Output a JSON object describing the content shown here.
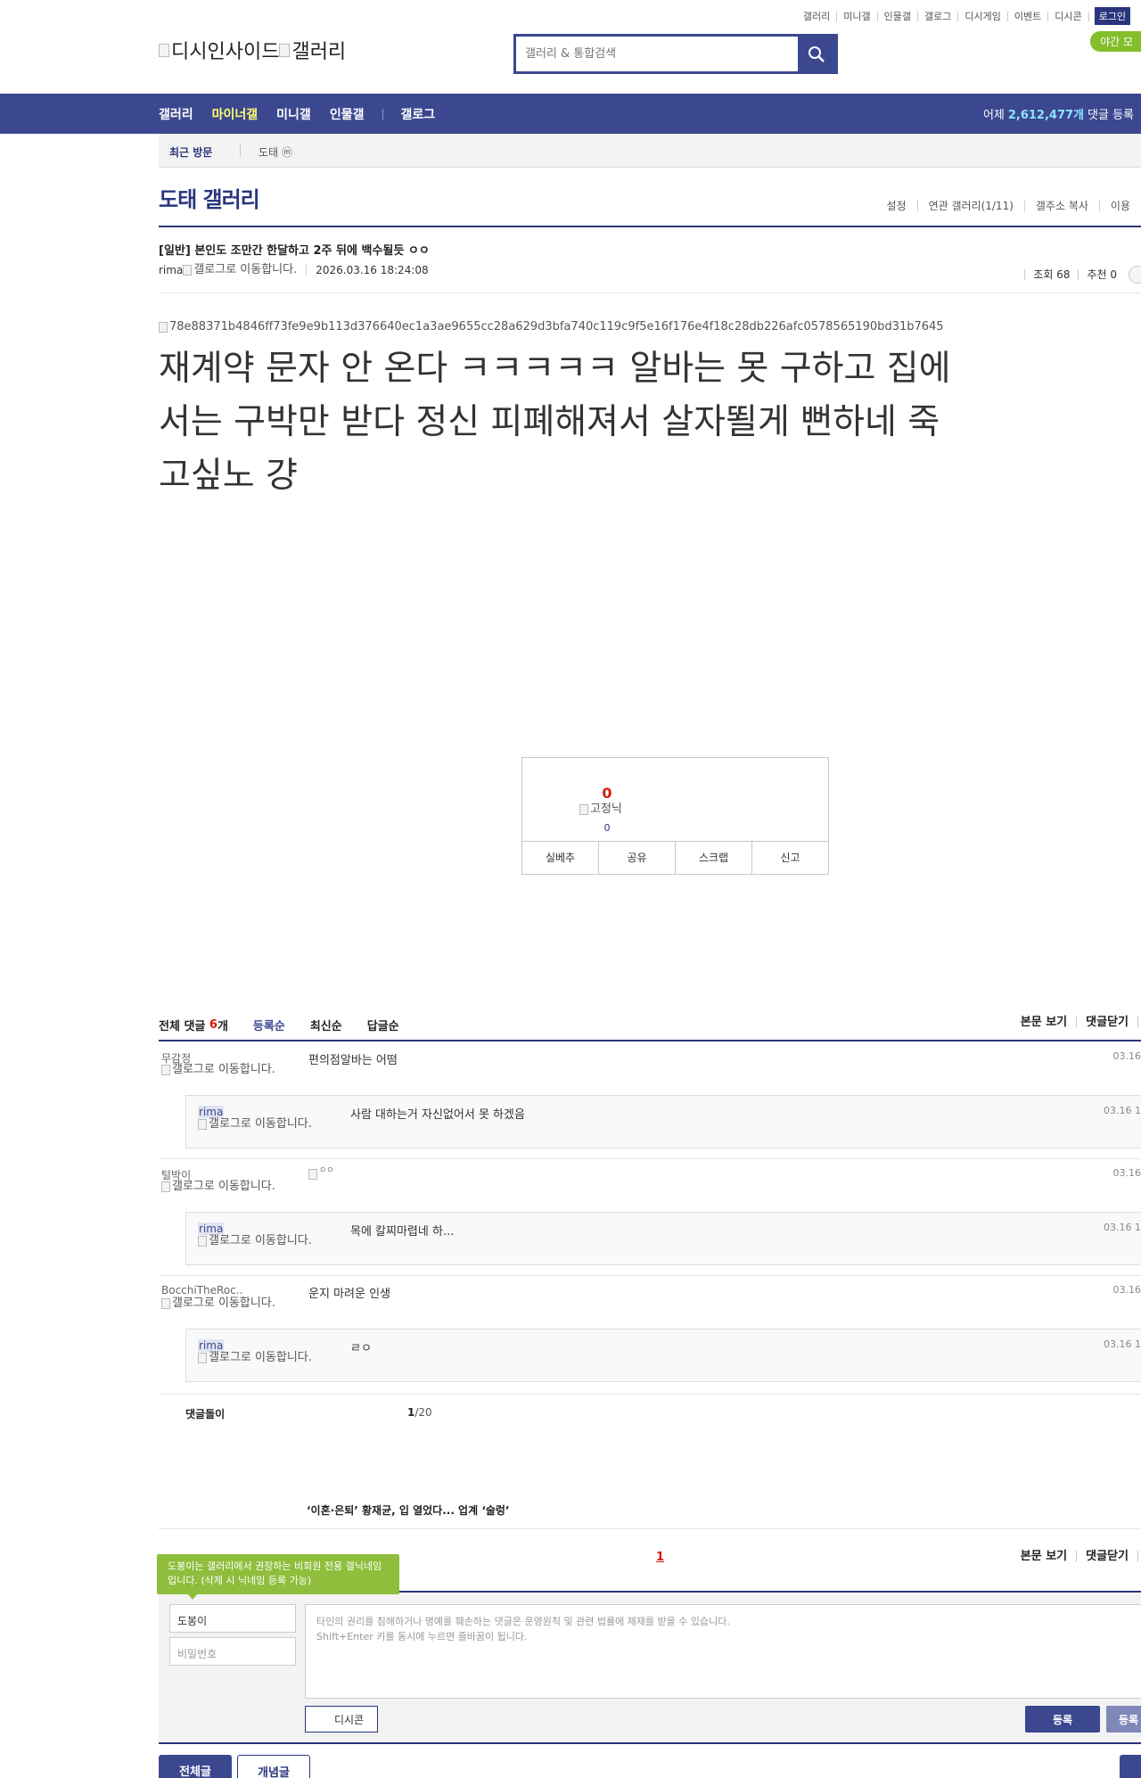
{
  "header": {
    "top_links": [
      "갤러리",
      "미니갤",
      "인물갤",
      "갤로그",
      "디시게임",
      "이벤트",
      "디시콘"
    ],
    "login_label": "로그인",
    "night_mode_label": "야간 모",
    "logo_alt": "디시인사이드",
    "logo_gallery_alt": "갤러리",
    "search_placeholder": "갤러리 & 통합검색"
  },
  "navbar": {
    "items": [
      "갤러리",
      "마이너갤",
      "미니갤",
      "인물갤"
    ],
    "active_index": 1,
    "gallog": "갤로그",
    "yesterday_prefix": "어제",
    "yesterday_count": "2,612,477개",
    "yesterday_suffix": "댓글 등록"
  },
  "recent": {
    "label": "최근 방문",
    "item": "도태 ⓜ"
  },
  "gallery": {
    "title": "도태 갤러리",
    "links": [
      "설정",
      "연관 갤러리(1/11)",
      "갤주소 복사",
      "이용"
    ]
  },
  "post": {
    "subject": "[일반] 본인도 조만간 한달하고 2주 뒤에 백수될듯 ㅇㅇ",
    "author": "rima",
    "author_icon_alt": "갤로그로 이동합니다.",
    "date": "2026.03.16 18:24:08",
    "views_label": "조회 68",
    "recommend_label": "추천 0",
    "image_alt": "78e88371b4846ff73fe9e9b113d376640ec1a3ae9655cc28a629d3bfa740c119c9f5e16f176e4f18c28db226afc0578565190bd31b7645",
    "body": "재계약 문자 안 온다 ㅋㅋㅋㅋㅋ 알바는 못 구하고 집에서는 구박만 받다 정신 피폐해져서 살자뙬게 뻔하네 죽고싶노 걍"
  },
  "recommend": {
    "up_count": "0",
    "fixed_alt": "고정닉",
    "fixed_count": "0",
    "buttons": [
      "실베추",
      "공유",
      "스크랩",
      "신고"
    ]
  },
  "comments_header": {
    "total_label": "전체 댓글",
    "total_count": "6",
    "total_unit": "개",
    "sort_tabs": [
      "등록순",
      "최신순",
      "답글순"
    ],
    "active_sort": 0,
    "right_links": [
      "본문 보기",
      "댓글닫기"
    ]
  },
  "comments": [
    {
      "nick": "무감정",
      "icon_alt": "갤로그로 이동합니다.",
      "text": "편의점알바는 어떰",
      "date": "03.16",
      "reply": {
        "nick": "rima",
        "icon_alt": "갤로그로 이동합니다.",
        "text": "사람 대하는거 자신없어서 못 하겠음",
        "date": "03.16 1"
      }
    },
    {
      "nick": "털박이",
      "icon_alt": "갤로그로 이동합니다.",
      "text": "",
      "dccon_alt": "ㅇㅇ",
      "date": "03.16",
      "reply": {
        "nick": "rima",
        "icon_alt": "갤로그로 이동합니다.",
        "text": "목에 칼찌마렵네 하...",
        "date": "03.16 1"
      }
    },
    {
      "nick": "BocchiTheRoc..",
      "icon_alt": "갤로그로 이동합니다.",
      "text": "운지 마려운 인생",
      "date": "03.16",
      "reply": {
        "nick": "rima",
        "icon_alt": "갤로그로 이동합니다.",
        "text": "ㄹㅇ",
        "date": "03.16 1"
      }
    }
  ],
  "paging": {
    "dolgo_label": "댓글돌이",
    "current": "1",
    "total": "/20"
  },
  "news_headline": "‘이혼·은퇴’ 황재균, 입 열었다... 업계 ‘술렁’",
  "bottom_pager": {
    "current": "1"
  },
  "write": {
    "tip": "도봉이는 갤러리에서 권장하는 비회원 전용 갤닉네임입니다. (삭제 시 닉네임 등록 가능)",
    "nick_value": "도봉이",
    "password_placeholder": "비밀번호",
    "memo_placeholder_1": "타인의 권리를 침해하거나 명예를 훼손하는 댓글은 운영원칙 및 관련 법률에 제재를 받을 수 있습니다.",
    "memo_placeholder_2": "Shift+Enter 키를 동시에 누르면 줄바꿈이 됩니다.",
    "dccon_label": "디시콘",
    "submit_label": "등록",
    "submit2_label": "등록"
  },
  "footer_buttons": {
    "all": "전체글",
    "concept": "개념글"
  }
}
